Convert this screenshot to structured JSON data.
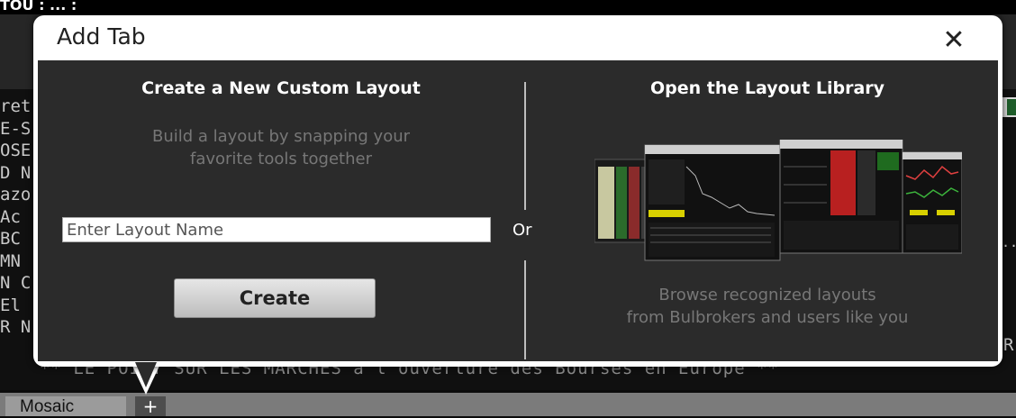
{
  "background": {
    "top_text": "TOU  :  ... :",
    "left_lines": [
      "ret",
      "E-S",
      "OSE",
      "D N",
      "azo",
      " Ac",
      "BC",
      "MN",
      "N C",
      "  El",
      "R N"
    ],
    "right_letter": "R",
    "right_dots": "...",
    "ticker": "** LE POINT SUR LES MARCHES a l'ouverture des Bourses en Europe **",
    "tabs": [
      {
        "label": "Mosaic"
      }
    ],
    "add_tab_label": "+"
  },
  "dialog": {
    "title": "Add Tab",
    "close_icon": "close-icon",
    "left": {
      "heading": "Create a New Custom Layout",
      "description_line1": "Build a layout by snapping your",
      "description_line2": "favorite tools together",
      "input_placeholder": "Enter Layout Name",
      "input_value": "",
      "create_label": "Create"
    },
    "or_label": "Or",
    "right": {
      "heading": "Open the Layout Library",
      "description_line1": "Browse recognized layouts",
      "description_line2": "from Bulbrokers and users like you"
    }
  },
  "colors": {
    "dialog_body": "#2b2b2b",
    "dialog_frame": "#ffffff",
    "accent_green": "#1e5d2a"
  }
}
